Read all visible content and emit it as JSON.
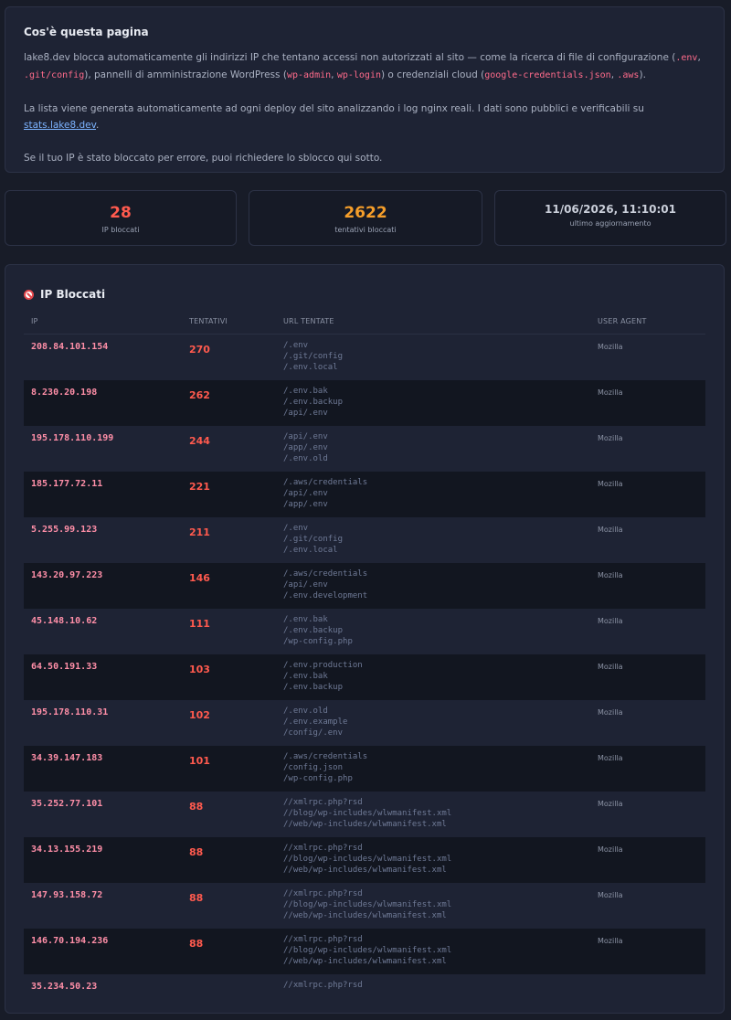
{
  "info": {
    "title": "Cos'è questa pagina",
    "p1_a": "lake8.dev blocca automaticamente gli indirizzi IP che tentano accessi non autorizzati al sito — come la ricerca di file di configurazione (",
    "code_env": ".env",
    "sep1": ",",
    "code_git": ".git/config",
    "p1_b": "), pannelli di amministrazione WordPress (",
    "code_wpadmin": "wp-admin",
    "sep2": ", ",
    "code_wplogin": "wp-login",
    "p1_c": ") o credenziali cloud (",
    "code_google": "google-credentials.json",
    "sep3": ", ",
    "code_aws": ".aws",
    "p1_d": ").",
    "p2_a": "La lista viene generata automaticamente ad ogni deploy del sito analizzando i log nginx reali. I dati sono pubblici e verificabili su ",
    "p2_link": "stats.lake8.dev",
    "p2_b": ".",
    "p3": "Se il tuo IP è stato bloccato per errore, puoi richiedere lo sblocco qui sotto."
  },
  "stats": [
    {
      "value": "28",
      "label": "IP bloccati",
      "color": "#ff5a4e"
    },
    {
      "value": "2622",
      "label": "tentativi bloccati",
      "color": "#f59e2a"
    },
    {
      "value": "11/06/2026, 11:10:01",
      "label": "ultimo aggiornamento",
      "color": "#c9ced9"
    }
  ],
  "table": {
    "title": "IP Bloccati",
    "icon": "no-entry-icon",
    "headers": [
      "IP",
      "TENTATIVI",
      "URL TENTATE",
      "USER AGENT"
    ],
    "rows": [
      {
        "ip": "208.84.101.154",
        "attempts": "270",
        "urls": [
          "/.env",
          "/.git/config",
          "/.env.local"
        ],
        "ua": "Mozilla"
      },
      {
        "ip": "8.230.20.198",
        "attempts": "262",
        "urls": [
          "/.env.bak",
          "/.env.backup",
          "/api/.env"
        ],
        "ua": "Mozilla"
      },
      {
        "ip": "195.178.110.199",
        "attempts": "244",
        "urls": [
          "/api/.env",
          "/app/.env",
          "/.env.old"
        ],
        "ua": "Mozilla"
      },
      {
        "ip": "185.177.72.11",
        "attempts": "221",
        "urls": [
          "/.aws/credentials",
          "/api/.env",
          "/app/.env"
        ],
        "ua": "Mozilla"
      },
      {
        "ip": "5.255.99.123",
        "attempts": "211",
        "urls": [
          "/.env",
          "/.git/config",
          "/.env.local"
        ],
        "ua": "Mozilla"
      },
      {
        "ip": "143.20.97.223",
        "attempts": "146",
        "urls": [
          "/.aws/credentials",
          "/api/.env",
          "/.env.development"
        ],
        "ua": "Mozilla"
      },
      {
        "ip": "45.148.10.62",
        "attempts": "111",
        "urls": [
          "/.env.bak",
          "/.env.backup",
          "/wp-config.php"
        ],
        "ua": "Mozilla"
      },
      {
        "ip": "64.50.191.33",
        "attempts": "103",
        "urls": [
          "/.env.production",
          "/.env.bak",
          "/.env.backup"
        ],
        "ua": "Mozilla"
      },
      {
        "ip": "195.178.110.31",
        "attempts": "102",
        "urls": [
          "/.env.old",
          "/.env.example",
          "/config/.env"
        ],
        "ua": "Mozilla"
      },
      {
        "ip": "34.39.147.183",
        "attempts": "101",
        "urls": [
          "/.aws/credentials",
          "/config.json",
          "/wp-config.php"
        ],
        "ua": "Mozilla"
      },
      {
        "ip": "35.252.77.101",
        "attempts": "88",
        "urls": [
          "//xmlrpc.php?rsd",
          "//blog/wp-includes/wlwmanifest.xml",
          "//web/wp-includes/wlwmanifest.xml"
        ],
        "ua": "Mozilla"
      },
      {
        "ip": "34.13.155.219",
        "attempts": "88",
        "urls": [
          "//xmlrpc.php?rsd",
          "//blog/wp-includes/wlwmanifest.xml",
          "//web/wp-includes/wlwmanifest.xml"
        ],
        "ua": "Mozilla"
      },
      {
        "ip": "147.93.158.72",
        "attempts": "88",
        "urls": [
          "//xmlrpc.php?rsd",
          "//blog/wp-includes/wlwmanifest.xml",
          "//web/wp-includes/wlwmanifest.xml"
        ],
        "ua": "Mozilla"
      },
      {
        "ip": "146.70.194.236",
        "attempts": "88",
        "urls": [
          "//xmlrpc.php?rsd",
          "//blog/wp-includes/wlwmanifest.xml",
          "//web/wp-includes/wlwmanifest.xml"
        ],
        "ua": "Mozilla"
      },
      {
        "ip": "35.234.50.23",
        "attempts": "",
        "urls": [
          "//xmlrpc.php?rsd",
          "",
          ""
        ],
        "ua": ""
      }
    ]
  }
}
